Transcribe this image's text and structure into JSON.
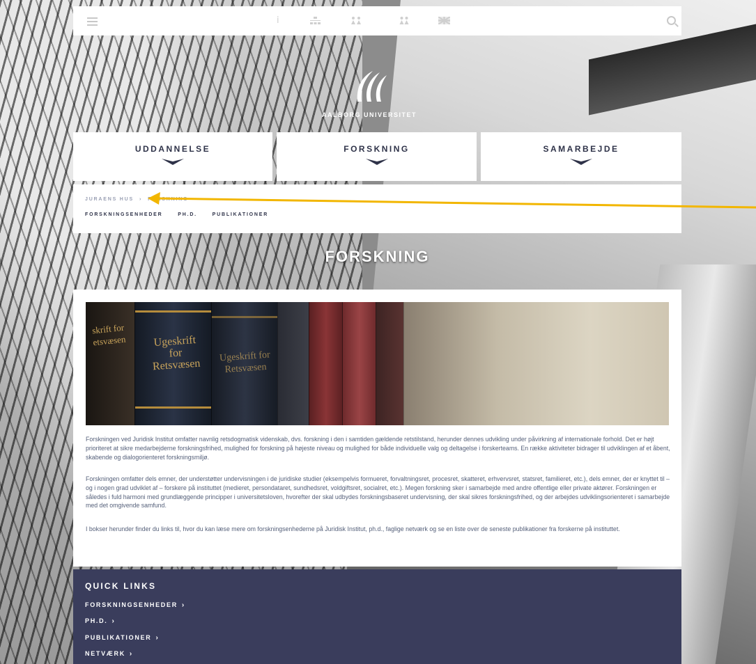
{
  "topbar": {
    "icons": [
      "menu-icon",
      "info-icon",
      "sitemap-icon",
      "people-icon",
      "group-icon",
      "uk-flag-icon",
      "search-icon"
    ],
    "info_glyph": "i"
  },
  "brand": {
    "name": "AALBORG UNIVERSITET"
  },
  "main_nav": [
    {
      "label": "UDDANNELSE"
    },
    {
      "label": "FORSKNING"
    },
    {
      "label": "SAMARBEJDE"
    }
  ],
  "breadcrumb": {
    "items": [
      "JURAENS HUS",
      "FORSKNING"
    ]
  },
  "subnav": {
    "items": [
      "FORSKNINGSENHEDER",
      "PH.D.",
      "PUBLIKATIONER"
    ]
  },
  "page_title": "FORSKNING",
  "hero": {
    "spines": [
      "Ugeskrift for Retsvæsen",
      "Ugeskrift for Retsvæsen"
    ],
    "left_spine": "skrift for etsvæsen"
  },
  "content": {
    "paragraphs": [
      "Forskningen ved Juridisk Institut omfatter navnlig retsdogmatisk videnskab, dvs. forskning i den i samtiden gældende retstilstand, herunder dennes udvikling under påvirkning af internationale forhold. Det er højt prioriteret at sikre medarbejderne forskningsfrihed, mulighed for forskning på højeste niveau og mulighed for både individuelle valg og deltagelse i forskerteams. En række aktiviteter bidrager til udviklingen af et åbent, skabende og dialogorienteret forskningsmiljø.",
      "Forskningen omfatter dels emner, der understøtter undervisningen i de juridiske studier (eksempelvis formueret, forvaltningsret, procesret, skatteret, erhvervsret, statsret, familieret, etc.), dels emner, der er knyttet til – og i nogen grad udviklet af – forskere på instituttet (medieret, persondataret, sundhedsret, voldgiftsret, socialret, etc.). Megen forskning sker i samarbejde med andre offentlige eller private aktører. Forskningen er således i fuld harmoni med grundlæggende principper i universitetsloven, hvorefter der skal udbydes forskningsbaseret undervisning, der skal sikres forskningsfrihed, og der arbejdes udviklingsorienteret i samarbejde med det omgivende samfund.",
      "I bokser herunder finder du links til, hvor du kan læse mere om forskningsenhederne på Juridisk Institut, ph.d., faglige netværk og se en liste over de seneste publikationer fra forskerne på instituttet."
    ]
  },
  "quick_links": {
    "title": "QUICK LINKS",
    "items": [
      "FORSKNINGSENHEDER",
      "PH.D.",
      "PUBLIKATIONER",
      "NETVÆRK"
    ],
    "arrow": "›"
  },
  "colors": {
    "navy": "#2f3349",
    "quick_bg": "#3a3d5c",
    "annotation_arrow": "#f2b600"
  }
}
